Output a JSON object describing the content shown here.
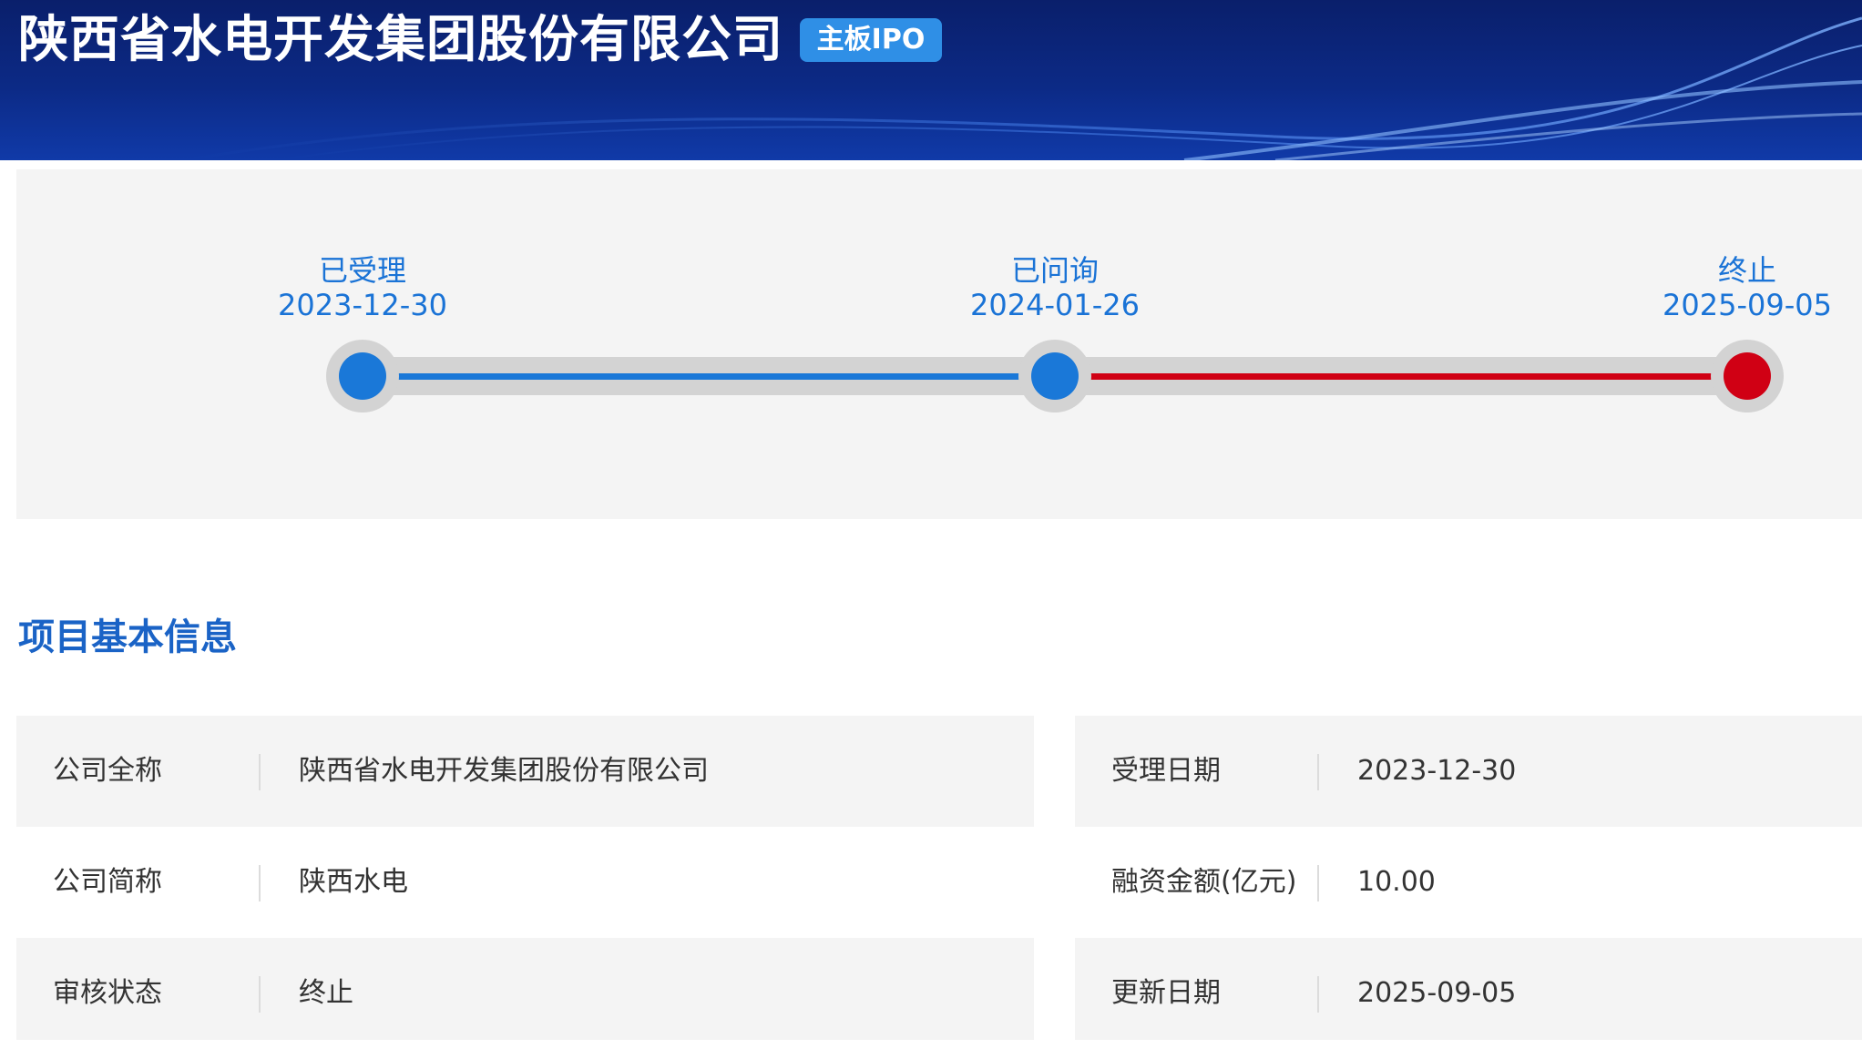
{
  "header": {
    "company_name": "陕西省水电开发集团股份有限公司",
    "board_badge": "主板IPO"
  },
  "timeline": {
    "steps": [
      {
        "label": "已受理",
        "date": "2023-12-30",
        "status_color": "#1a78d8"
      },
      {
        "label": "已问询",
        "date": "2024-01-26",
        "status_color": "#1a78d8"
      },
      {
        "label": "终止",
        "date": "2025-09-05",
        "status_color": "#d00014"
      }
    ]
  },
  "section": {
    "title": "项目基本信息"
  },
  "info": {
    "left": [
      {
        "label": "公司全称",
        "value": "陕西省水电开发集团股份有限公司"
      },
      {
        "label": "公司简称",
        "value": "陕西水电"
      },
      {
        "label": "审核状态",
        "value": "终止"
      }
    ],
    "right": [
      {
        "label": "受理日期",
        "value": "2023-12-30"
      },
      {
        "label": "融资金额(亿元)",
        "value": "10.00"
      },
      {
        "label": "更新日期",
        "value": "2025-09-05"
      }
    ]
  },
  "colors": {
    "accent_blue": "#1a78d8",
    "terminated_red": "#d00014",
    "header_bg": "#0c2a86",
    "badge_bg": "#2f8fe6"
  }
}
